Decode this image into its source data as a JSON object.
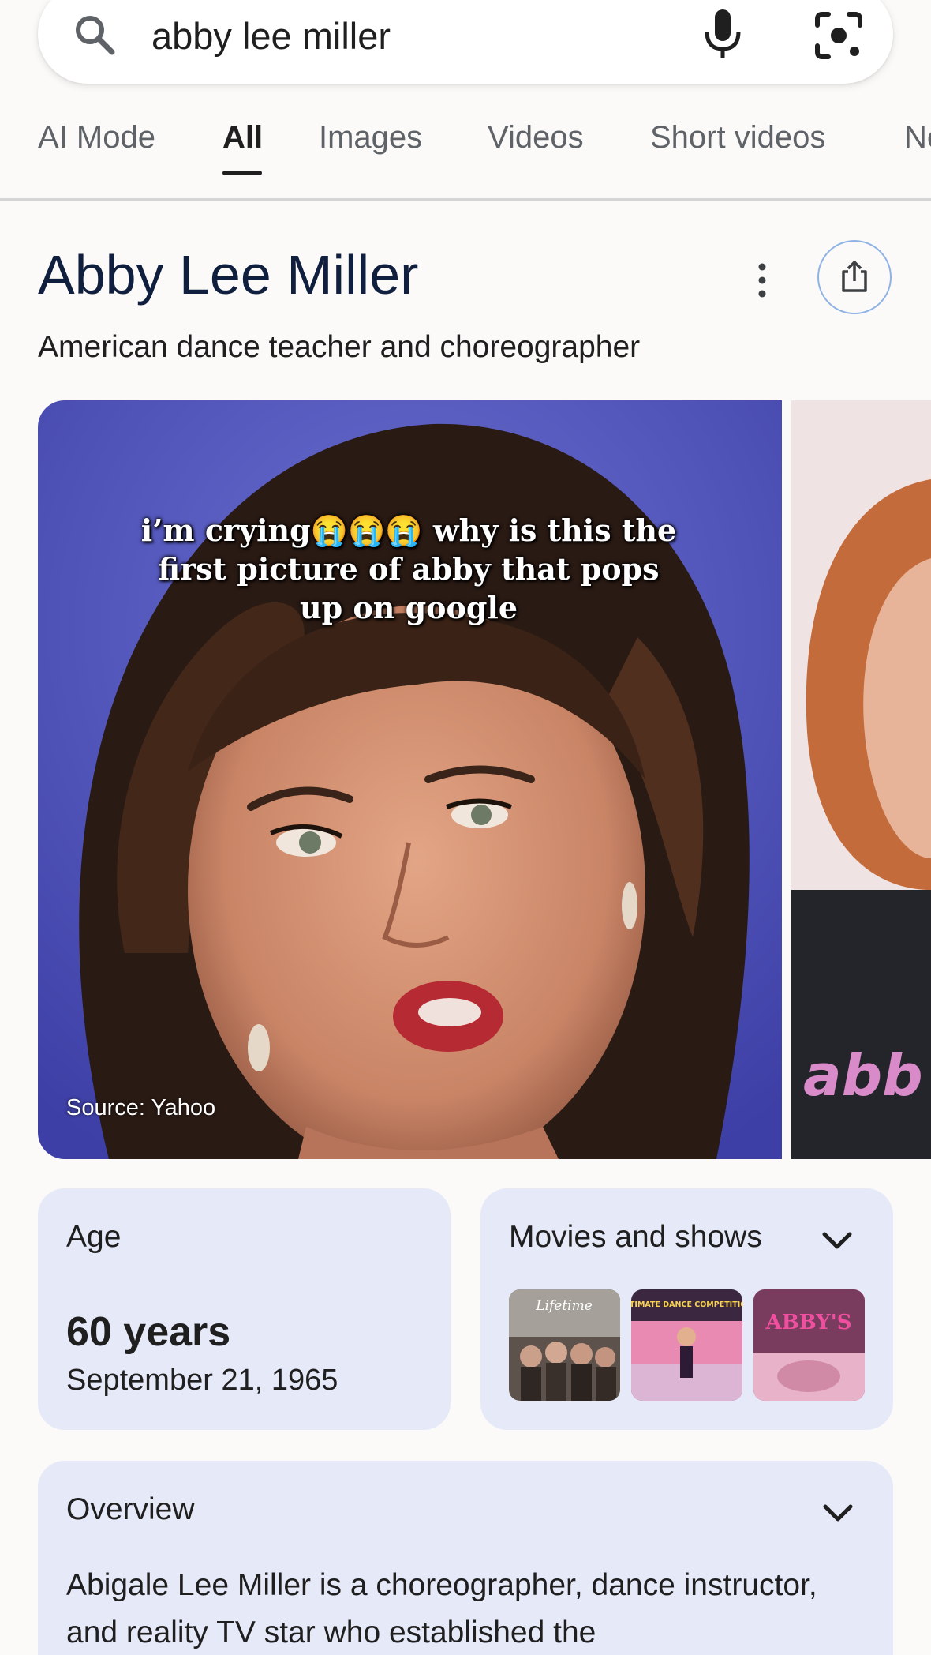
{
  "search": {
    "query": "abby lee miller",
    "icons": [
      "search-icon",
      "mic-icon",
      "lens-icon"
    ]
  },
  "tabs": [
    {
      "label": "AI Mode",
      "active": false
    },
    {
      "label": "All",
      "active": true
    },
    {
      "label": "Images",
      "active": false
    },
    {
      "label": "Videos",
      "active": false
    },
    {
      "label": "Short videos",
      "active": false
    },
    {
      "label": "Ne",
      "active": false
    }
  ],
  "knowledge_panel": {
    "title": "Abby Lee Miller",
    "subtitle": "American dance teacher and choreographer",
    "image": {
      "caption": "i’m crying😭😭😭 why is this the first picture of abby that pops up on google",
      "source": "Source: Yahoo"
    },
    "age": {
      "label": "Age",
      "value": "60 years",
      "birthdate": "September 21, 1965"
    },
    "movies": {
      "label": "Movies and shows",
      "thumbnails": [
        {
          "text": "Lifetime"
        },
        {
          "text": "ULTIMATE DANCE COMPETITION"
        },
        {
          "text": "ABBY'S"
        }
      ]
    },
    "overview": {
      "label": "Overview",
      "text": "Abigale Lee Miller is a choreographer, dance instructor, and reality TV star who established the"
    }
  },
  "colors": {
    "card_bg": "#e6e9f8",
    "title": "#0f1f3d",
    "tab_inactive": "#5f6368",
    "share_border": "#8fb3e6"
  }
}
